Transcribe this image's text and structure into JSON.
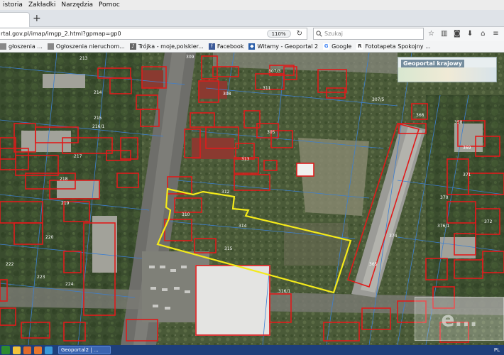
{
  "menubar": {
    "items": [
      "istoria",
      "Zakładki",
      "Narzędzia",
      "Pomoc"
    ]
  },
  "tabs": {
    "new_tab_symbol": "+"
  },
  "navbar": {
    "url": "rtal.gov.pl/imap/imgp_2.html?gpmap=gp0",
    "zoom": "110%",
    "reload_symbol": "↻",
    "search_placeholder": "Szukaj",
    "icons": [
      "star-icon",
      "library-icon",
      "pocket-icon",
      "download-icon",
      "home-icon",
      "hamburger-menu-icon"
    ]
  },
  "bookmarks": [
    {
      "label": "głoszenia ...",
      "icon": "page-icon",
      "color": "#888888"
    },
    {
      "label": "Ogłoszenia nieruchom...",
      "icon": "page-icon",
      "color": "#888888"
    },
    {
      "label": "Trójka - moje,polskier...",
      "icon": "radio-icon",
      "color": "#666666"
    },
    {
      "label": "Facebook",
      "icon": "facebook-icon",
      "color": "#3b5998"
    },
    {
      "label": "Witamy - Geoportal 2",
      "icon": "geoportal-icon",
      "color": "#2a5ea8"
    },
    {
      "label": "Google",
      "icon": "google-icon",
      "color": "#4285f4"
    },
    {
      "label": "Fototapeta Spokojny ...",
      "icon": "r-icon",
      "color": "#333333"
    }
  ],
  "map": {
    "minimap_title": "Geoportal krajowy",
    "parcel_labels": [
      "309",
      "311",
      "308",
      "305",
      "310",
      "314",
      "315",
      "313",
      "312",
      "307/3",
      "307/5",
      "216/1",
      "217",
      "218",
      "219",
      "220",
      "222",
      "223",
      "224",
      "214",
      "215",
      "213",
      "374",
      "376/1",
      "371",
      "372",
      "369",
      "366",
      "316/1",
      "370",
      "365",
      "358"
    ],
    "watermark": "e..."
  },
  "taskbar": {
    "active_task": "Geoportal2 | ...",
    "tray_text": "PL"
  }
}
